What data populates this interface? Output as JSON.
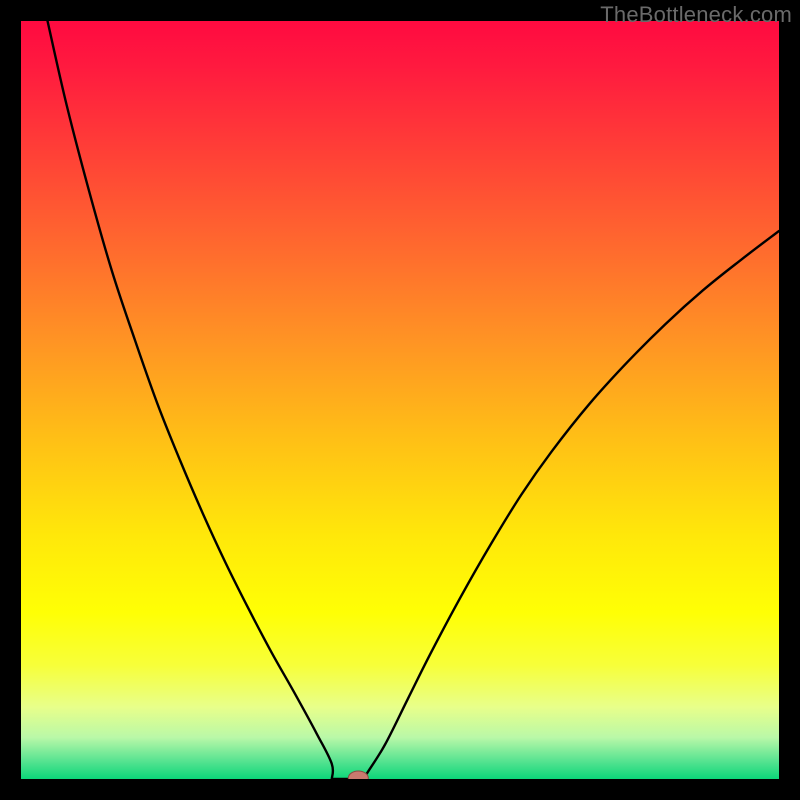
{
  "watermark": "TheBottleneck.com",
  "colors": {
    "frame": "#000000",
    "gradient_stops": [
      {
        "offset": 0.0,
        "color": "#ff0a40"
      },
      {
        "offset": 0.06,
        "color": "#ff1a3f"
      },
      {
        "offset": 0.18,
        "color": "#ff4236"
      },
      {
        "offset": 0.3,
        "color": "#ff6a2e"
      },
      {
        "offset": 0.42,
        "color": "#ff9324"
      },
      {
        "offset": 0.55,
        "color": "#ffbf16"
      },
      {
        "offset": 0.68,
        "color": "#ffe80a"
      },
      {
        "offset": 0.78,
        "color": "#ffff05"
      },
      {
        "offset": 0.85,
        "color": "#f7ff3a"
      },
      {
        "offset": 0.905,
        "color": "#e8ff8a"
      },
      {
        "offset": 0.945,
        "color": "#baf8a8"
      },
      {
        "offset": 0.975,
        "color": "#5be492"
      },
      {
        "offset": 1.0,
        "color": "#0cd679"
      }
    ],
    "curve_stroke": "#000000",
    "marker_fill": "#c9796e",
    "marker_stroke": "#8a4d44"
  },
  "chart_data": {
    "type": "line",
    "title": "",
    "xlabel": "",
    "ylabel": "",
    "x_range": [
      0,
      100
    ],
    "y_range": [
      0,
      100
    ],
    "marker": {
      "x": 44.5,
      "y": 0
    },
    "flat_segment": {
      "x_start": 41.0,
      "x_end": 45.5,
      "y": 0
    },
    "series": [
      {
        "name": "left-branch",
        "x": [
          3.5,
          6,
          9,
          12,
          15,
          18,
          21,
          24,
          27,
          30,
          33,
          36,
          39,
          41
        ],
        "y": [
          100,
          89,
          77.5,
          67,
          58,
          49.5,
          42,
          35,
          28.5,
          22.5,
          16.8,
          11.5,
          6,
          2.0
        ]
      },
      {
        "name": "right-branch",
        "x": [
          45.5,
          48,
          51,
          54,
          58,
          62,
          66,
          70,
          75,
          80,
          85,
          90,
          95,
          100
        ],
        "y": [
          0.5,
          4.5,
          10.5,
          16.5,
          24,
          31,
          37.5,
          43.2,
          49.5,
          55,
          60,
          64.5,
          68.5,
          72.3
        ]
      }
    ]
  }
}
